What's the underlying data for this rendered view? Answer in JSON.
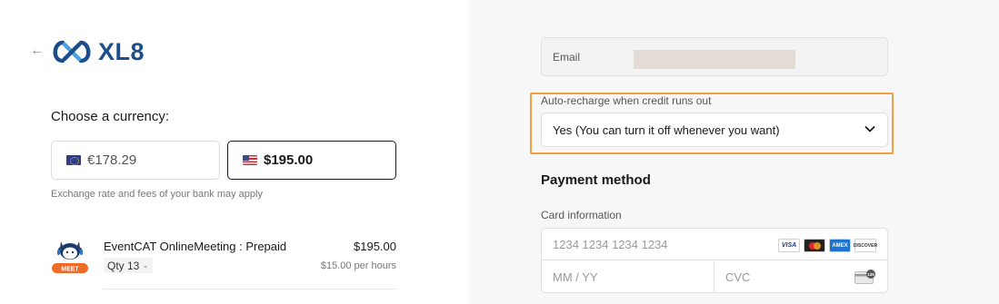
{
  "nav": {
    "back_icon": "arrow-left-icon"
  },
  "brand": {
    "name": "XL8",
    "color": "#1d4e8c"
  },
  "currency": {
    "heading": "Choose a currency:",
    "options": [
      {
        "code": "EUR",
        "label": "€178.29",
        "flag_icon": "eu-flag-icon",
        "selected": false
      },
      {
        "code": "USD",
        "label": "$195.00",
        "flag_icon": "us-flag-icon",
        "selected": true
      }
    ],
    "note": "Exchange rate and fees of your bank may apply"
  },
  "product": {
    "icon": "eventcat-meet-icon",
    "badge": "MEET",
    "name": "EventCAT OnlineMeeting : Prepaid",
    "price": "$195.00",
    "qty_label": "Qty 13",
    "unit_price": "$15.00 per hours"
  },
  "email": {
    "label": "Email"
  },
  "auto_recharge": {
    "label": "Auto-recharge when credit runs out",
    "value": "Yes (You can turn it off whenever you want)",
    "highlight_color": "#f0a040"
  },
  "payment": {
    "heading": "Payment method",
    "card_label": "Card information",
    "card_number_placeholder": "1234 1234 1234 1234",
    "expiry_placeholder": "MM / YY",
    "cvc_placeholder": "CVC",
    "brands": [
      "VISA",
      "mastercard",
      "AMEX",
      "DISCOVER"
    ],
    "cvc_badge": "135"
  }
}
